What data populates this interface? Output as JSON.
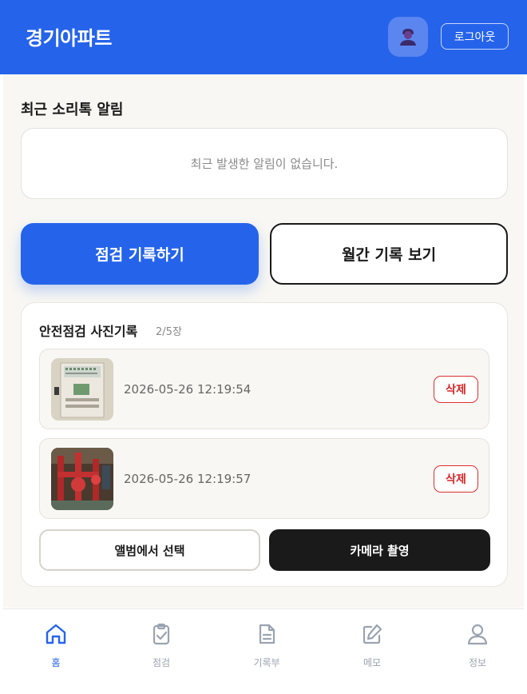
{
  "header": {
    "title": "경기아파트",
    "logout_label": "로그아웃"
  },
  "alerts": {
    "section_title": "최근 소리톡 알림",
    "empty_message": "최근 발생한 알림이 없습니다."
  },
  "actions": {
    "record_label": "점검 기록하기",
    "monthly_label": "월간 기록 보기"
  },
  "photos": {
    "title": "안전점검 사진기록",
    "count": "2/5장",
    "items": [
      {
        "timestamp": "2026-05-26 12:19:54",
        "delete_label": "삭제"
      },
      {
        "timestamp": "2026-05-26 12:19:57",
        "delete_label": "삭제"
      }
    ],
    "album_label": "앨범에서 선택",
    "camera_label": "카메라 촬영"
  },
  "nav": {
    "items": [
      {
        "label": "홈",
        "icon": "home-icon",
        "active": true
      },
      {
        "label": "점검",
        "icon": "clipboard-check-icon",
        "active": false
      },
      {
        "label": "기록부",
        "icon": "document-icon",
        "active": false
      },
      {
        "label": "메모",
        "icon": "edit-icon",
        "active": false
      },
      {
        "label": "정보",
        "icon": "user-icon",
        "active": false
      }
    ]
  },
  "colors": {
    "primary": "#2563eb",
    "danger": "#d02828",
    "dark": "#1a1a1a",
    "background": "#f8f7f3"
  }
}
